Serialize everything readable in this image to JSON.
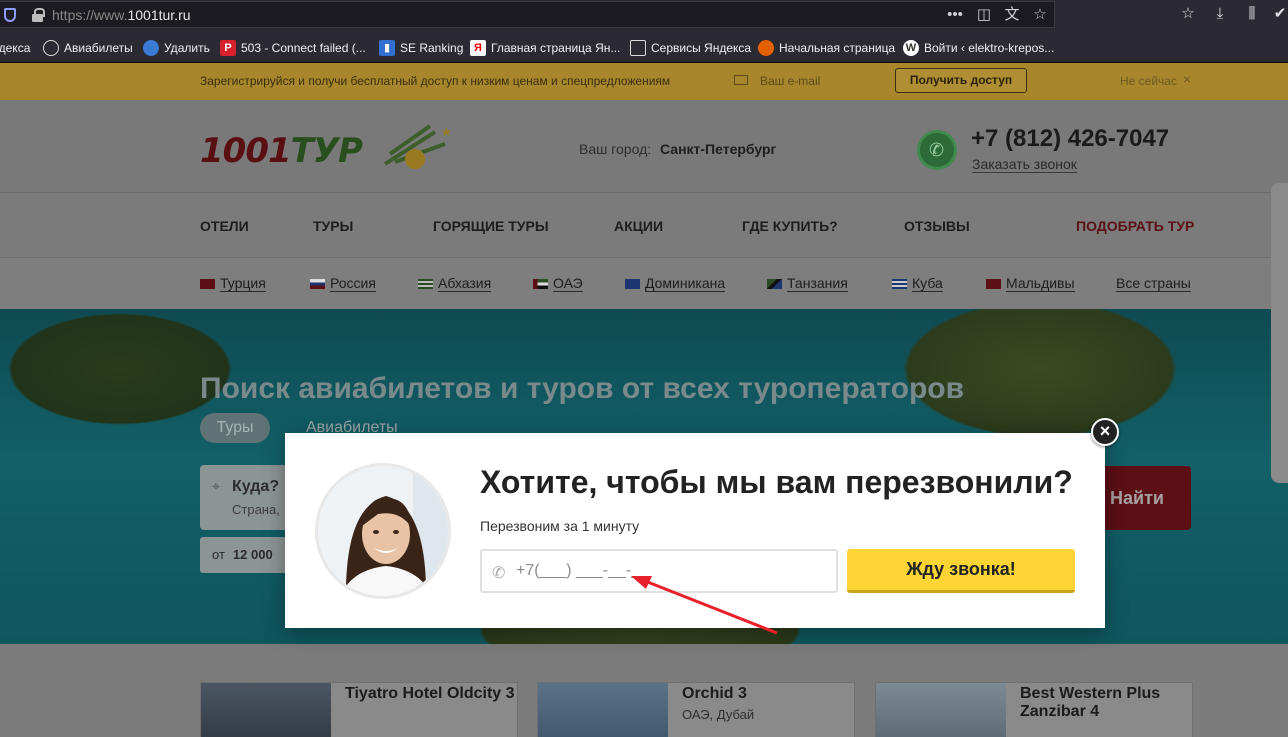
{
  "browser": {
    "url_prefix": "https://www.",
    "url_domain": "1001tur.ru",
    "bookmarks": [
      {
        "label": "ндекса"
      },
      {
        "label": "Авиабилеты"
      },
      {
        "label": "Удалить"
      },
      {
        "label": "503 - Connect failed (..."
      },
      {
        "label": "SE Ranking"
      },
      {
        "label": "Главная страница Ян..."
      },
      {
        "label": "Сервисы Яндекса"
      },
      {
        "label": "Начальная страница"
      },
      {
        "label": "Войти ‹ elektro-krepos..."
      }
    ]
  },
  "promo": {
    "text": "Зарегистрируйся и получи бесплатный доступ к низким ценам и спецпредложениям",
    "email_placeholder": "Ваш e-mail",
    "button": "Получить доступ",
    "skip": "Не сейчас",
    "close": "×"
  },
  "header": {
    "logo": "1001ТУР",
    "city_label": "Ваш город:",
    "city_value": "Санкт-Петербург",
    "phone": "+7 (812) 426-7047",
    "callback": "Заказать звонок"
  },
  "nav": [
    {
      "label": "ОТЕЛИ"
    },
    {
      "label": "ТУРЫ"
    },
    {
      "label": "ГОРЯЩИЕ ТУРЫ"
    },
    {
      "label": "АКЦИИ"
    },
    {
      "label": "ГДЕ КУПИТЬ?"
    },
    {
      "label": "ОТЗЫВЫ"
    },
    {
      "label": "ПОДОБРАТЬ ТУР"
    }
  ],
  "countries": [
    {
      "label": "Турция"
    },
    {
      "label": "Россия"
    },
    {
      "label": "Абхазия"
    },
    {
      "label": "ОАЭ"
    },
    {
      "label": "Доминикана"
    },
    {
      "label": "Танзания"
    },
    {
      "label": "Куба"
    },
    {
      "label": "Мальдивы"
    },
    {
      "label": "Все страны"
    }
  ],
  "hero": {
    "title": "Поиск авиабилетов и туров от всех туроператоров",
    "tab_tours": "Туры",
    "tab_flights": "Авиабилеты",
    "dest_label": "Куда?",
    "dest_sub": "Страна,",
    "price_prefix": "от",
    "price_value": "12 000",
    "find": "Найти"
  },
  "hotels": [
    {
      "name": "Tiyatro Hotel Oldcity 3",
      "location": ""
    },
    {
      "name": "Orchid 3",
      "location": "ОАЭ, Дубай"
    },
    {
      "name": "Best Western Plus Zanzibar 4",
      "location": ""
    }
  ],
  "modal": {
    "title": "Хотите, чтобы мы вам перезвонили?",
    "subtitle": "Перезвоним за 1 минуту",
    "phone_placeholder": "+7(___) ___-__-__",
    "button": "Жду звонка!",
    "close": "×"
  },
  "colors": {
    "accent_yellow": "#fcd535",
    "brand_red": "#c8102e",
    "arrow": "#e8202a"
  }
}
